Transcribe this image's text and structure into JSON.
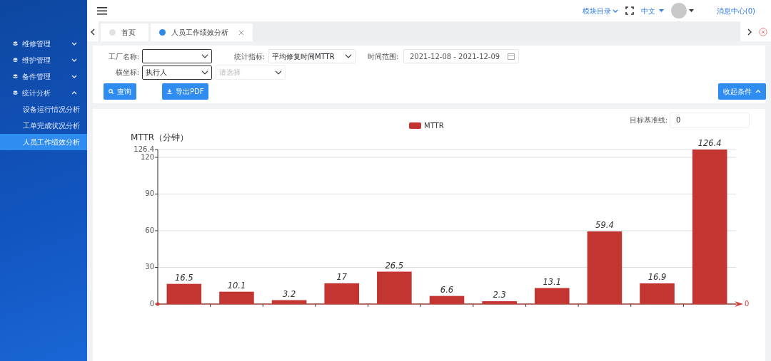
{
  "sidebar": {
    "items": [
      {
        "label": "维修管理",
        "expanded": false
      },
      {
        "label": "维护管理",
        "expanded": false
      },
      {
        "label": "备件管理",
        "expanded": false
      },
      {
        "label": "统计分析",
        "expanded": true,
        "children": [
          {
            "label": "设备运行情况分析",
            "selected": false
          },
          {
            "label": "工单完成状况分析",
            "selected": false
          },
          {
            "label": "人员工作绩效分析",
            "selected": true
          }
        ]
      }
    ]
  },
  "topbar": {
    "module_menu": "模块目录",
    "language": "中文",
    "messages": "消息中心(0)"
  },
  "tabs": [
    {
      "label": "首页",
      "selected": false,
      "closable": false
    },
    {
      "label": "人员工作绩效分析",
      "selected": true,
      "closable": true
    }
  ],
  "filters": {
    "factory": {
      "label": "工厂名称:"
    },
    "metric": {
      "label": "统计指标:",
      "value": "平均修复时间MTTR"
    },
    "time_range": {
      "label": "时间范围:",
      "value": "2021-12-08 - 2021-12-09"
    },
    "x_axis": {
      "label": "横坐标:",
      "value": "执行人"
    },
    "x_axis_detail": {
      "placeholder": "请选择"
    },
    "buttons": [
      {
        "label": "查询",
        "kind": "search"
      },
      {
        "label": "导出PDF",
        "kind": "download"
      }
    ],
    "collapse_button": "收起条件"
  },
  "chart_panel": {
    "baseline": {
      "label": "目标基准线:",
      "value": "0"
    },
    "chart_data": {
      "type": "bar",
      "ylabel": "MTTR（分钟）",
      "series": [
        {
          "name": "MTTR",
          "color": "#c23531",
          "values": [
            16.5,
            10.1,
            3.2,
            17,
            26.5,
            6.6,
            2.3,
            13.1,
            59.4,
            16.9,
            126.4
          ]
        }
      ],
      "ylim": [
        0,
        126.4
      ],
      "yticks": [
        0,
        30,
        60,
        90,
        120,
        126.4
      ],
      "data_labels": true,
      "grid": true
    },
    "baseline_line_label": "0"
  }
}
